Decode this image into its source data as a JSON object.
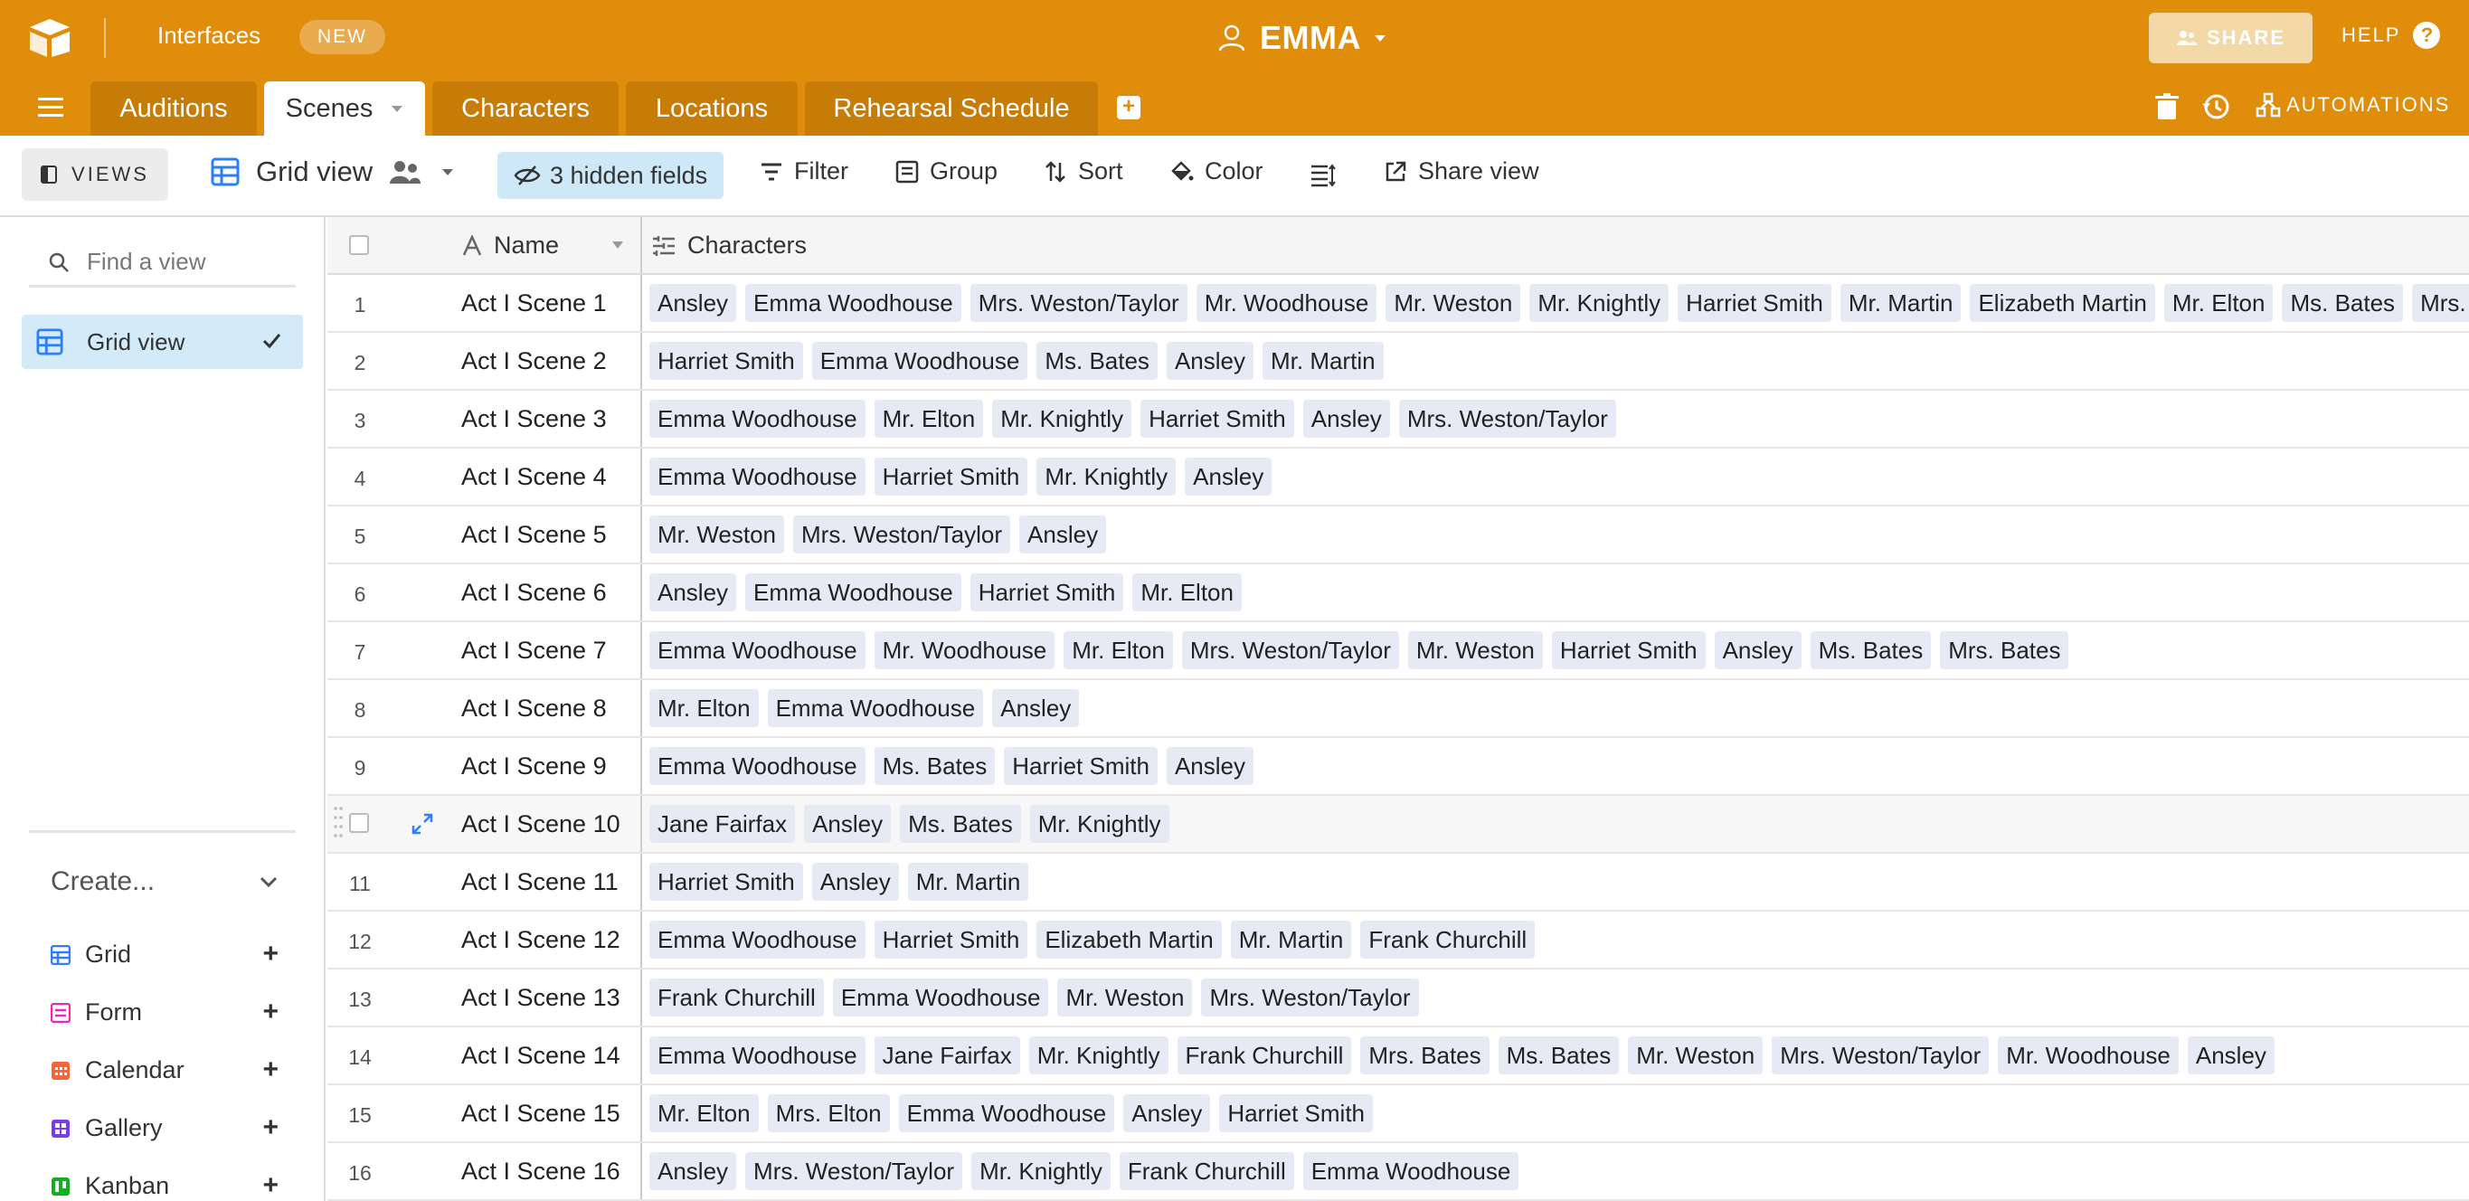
{
  "app": {
    "interfaces_label": "Interfaces",
    "new_badge": "NEW",
    "base_name": "EMMA",
    "share_label": "SHARE",
    "help_label": "HELP",
    "help_glyph": "?",
    "accent_color": "#e08d0b"
  },
  "tabs": [
    {
      "label": "Auditions",
      "active": false
    },
    {
      "label": "Scenes",
      "active": true
    },
    {
      "label": "Characters",
      "active": false
    },
    {
      "label": "Locations",
      "active": false
    },
    {
      "label": "Rehearsal Schedule",
      "active": false
    }
  ],
  "tabbar_right": {
    "automations_label": "AUTOMATIONS"
  },
  "viewbar": {
    "views_label": "VIEWS",
    "view_name": "Grid view",
    "hidden_fields_label": "3 hidden fields",
    "filter_label": "Filter",
    "group_label": "Group",
    "sort_label": "Sort",
    "color_label": "Color",
    "share_view_label": "Share view"
  },
  "sidebar": {
    "find_placeholder": "Find a view",
    "active_view": "Grid view",
    "create_label": "Create...",
    "create_items": [
      {
        "label": "Grid",
        "color": "#2d7ff9"
      },
      {
        "label": "Form",
        "color": "#e929ba"
      },
      {
        "label": "Calendar",
        "color": "#f7653b"
      },
      {
        "label": "Gallery",
        "color": "#7c39ed"
      },
      {
        "label": "Kanban",
        "color": "#11af22"
      }
    ]
  },
  "grid": {
    "columns": [
      "Name",
      "Characters"
    ],
    "rows": [
      {
        "num": "1",
        "name": "Act I Scene 1",
        "characters": [
          "Ansley",
          "Emma Woodhouse",
          "Mrs. Weston/Taylor",
          "Mr. Woodhouse",
          "Mr. Weston",
          "Mr. Knightly",
          "Harriet Smith",
          "Mr. Martin",
          "Elizabeth Martin",
          "Mr. Elton",
          "Ms. Bates",
          "Mrs. Elton"
        ]
      },
      {
        "num": "2",
        "name": "Act I Scene 2",
        "characters": [
          "Harriet Smith",
          "Emma Woodhouse",
          "Ms. Bates",
          "Ansley",
          "Mr. Martin"
        ]
      },
      {
        "num": "3",
        "name": "Act I Scene 3",
        "characters": [
          "Emma Woodhouse",
          "Mr. Elton",
          "Mr. Knightly",
          "Harriet Smith",
          "Ansley",
          "Mrs. Weston/Taylor"
        ]
      },
      {
        "num": "4",
        "name": "Act I Scene 4",
        "characters": [
          "Emma Woodhouse",
          "Harriet Smith",
          "Mr. Knightly",
          "Ansley"
        ]
      },
      {
        "num": "5",
        "name": "Act I Scene 5",
        "characters": [
          "Mr. Weston",
          "Mrs. Weston/Taylor",
          "Ansley"
        ]
      },
      {
        "num": "6",
        "name": "Act I Scene 6",
        "characters": [
          "Ansley",
          "Emma Woodhouse",
          "Harriet Smith",
          "Mr. Elton"
        ]
      },
      {
        "num": "7",
        "name": "Act I Scene 7",
        "characters": [
          "Emma Woodhouse",
          "Mr. Woodhouse",
          "Mr. Elton",
          "Mrs. Weston/Taylor",
          "Mr. Weston",
          "Harriet Smith",
          "Ansley",
          "Ms. Bates",
          "Mrs. Bates"
        ]
      },
      {
        "num": "8",
        "name": "Act I Scene 8",
        "characters": [
          "Mr. Elton",
          "Emma Woodhouse",
          "Ansley"
        ]
      },
      {
        "num": "9",
        "name": "Act I Scene 9",
        "characters": [
          "Emma Woodhouse",
          "Ms. Bates",
          "Harriet Smith",
          "Ansley"
        ]
      },
      {
        "num": "",
        "name": "Act I Scene 10",
        "characters": [
          "Jane Fairfax",
          "Ansley",
          "Ms. Bates",
          "Mr. Knightly"
        ],
        "hover": true
      },
      {
        "num": "11",
        "name": "Act I Scene 11",
        "characters": [
          "Harriet Smith",
          "Ansley",
          "Mr. Martin"
        ]
      },
      {
        "num": "12",
        "name": "Act I Scene 12",
        "characters": [
          "Emma Woodhouse",
          "Harriet Smith",
          "Elizabeth Martin",
          "Mr. Martin",
          "Frank Churchill"
        ]
      },
      {
        "num": "13",
        "name": "Act I Scene 13",
        "characters": [
          "Frank Churchill",
          "Emma Woodhouse",
          "Mr. Weston",
          "Mrs. Weston/Taylor"
        ]
      },
      {
        "num": "14",
        "name": "Act I Scene 14",
        "characters": [
          "Emma Woodhouse",
          "Jane Fairfax",
          "Mr. Knightly",
          "Frank Churchill",
          "Mrs. Bates",
          "Ms. Bates",
          "Mr. Weston",
          "Mrs. Weston/Taylor",
          "Mr. Woodhouse",
          "Ansley"
        ]
      },
      {
        "num": "15",
        "name": "Act I Scene 15",
        "characters": [
          "Mr. Elton",
          "Mrs. Elton",
          "Emma Woodhouse",
          "Ansley",
          "Harriet Smith"
        ]
      },
      {
        "num": "16",
        "name": "Act I Scene 16",
        "characters": [
          "Ansley",
          "Mrs. Weston/Taylor",
          "Mr. Knightly",
          "Frank Churchill",
          "Emma Woodhouse"
        ]
      }
    ]
  }
}
